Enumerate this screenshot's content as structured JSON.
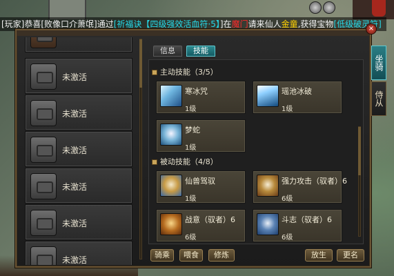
{
  "marquee": [
    {
      "text": "[玩家]恭喜[败像口介萧氓]通过",
      "cls": "mq-w"
    },
    {
      "text": "[祈福诀【四级强效活血符·5】",
      "cls": "mq-c"
    },
    {
      "text": "]在",
      "cls": "mq-w"
    },
    {
      "text": "魔门",
      "cls": "mq-r"
    },
    {
      "text": "请来仙人",
      "cls": "mq-w"
    },
    {
      "text": "金童",
      "cls": "mq-g"
    },
    {
      "text": ",获得宝物",
      "cls": "mq-w"
    },
    {
      "text": "[低级破灵符]",
      "cls": "mq-c"
    }
  ],
  "tabs": [
    {
      "label": "信息",
      "active": false
    },
    {
      "label": "技能",
      "active": true
    }
  ],
  "left_list": {
    "items": [
      {
        "label": "未激活"
      },
      {
        "label": "未激活"
      },
      {
        "label": "未激活"
      },
      {
        "label": "未激活"
      },
      {
        "label": "未激活"
      },
      {
        "label": "未激活"
      }
    ]
  },
  "active_skills": {
    "header": "主动技能（3/5）",
    "skills": [
      {
        "name": "寒冰咒",
        "level": "1级",
        "icon": "ice1"
      },
      {
        "name": "瑶池冰破",
        "level": "1级",
        "icon": "ice2"
      },
      {
        "name": "梦蛇",
        "level": "1级",
        "icon": "dream"
      }
    ]
  },
  "passive_skills": {
    "header": "被动技能（4/8）",
    "skills": [
      {
        "name": "仙兽驾驭",
        "level": "1级",
        "icon": "tiger1"
      },
      {
        "name": "强力攻击（驭者）6",
        "level": "6级",
        "icon": "tiger2"
      },
      {
        "name": "战意（驭者）6",
        "level": "6级",
        "icon": "tiger3"
      },
      {
        "name": "斗志（驭者）6",
        "level": "6级",
        "icon": "wolf"
      }
    ]
  },
  "buttons": {
    "ride": "骑乘",
    "feed": "喂食",
    "train": "修炼",
    "release": "放生",
    "rename": "更名"
  },
  "side_tabs": [
    {
      "label": "坐骑",
      "active": true
    },
    {
      "label": "侍从",
      "active": false
    }
  ],
  "close_label": "×"
}
